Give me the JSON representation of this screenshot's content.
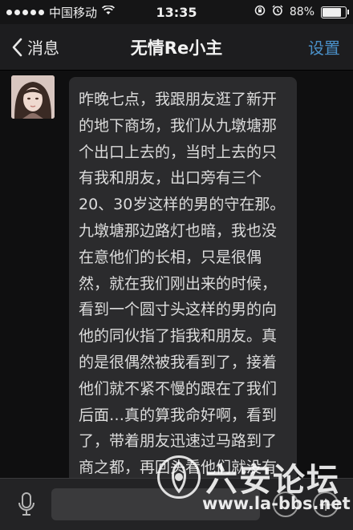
{
  "status_bar": {
    "carrier": "中国移动",
    "time": "13:35",
    "battery_percent_label": "88%",
    "battery_level": 0.88
  },
  "nav": {
    "back_label": "消息",
    "title": "无情Re小主",
    "settings_label": "设置"
  },
  "message": {
    "text": "昨晚七点，我跟朋友逛了新开的地下商场，我们从九墩塘那个出口上去的，当时上去的只有我和朋友，出口旁有三个20、30岁这样的男的守在那。九墩塘那边路灯也暗，我也没在意他们的长相，只是很偶然，就在我们刚出来的时候，看到一个圆寸头这样的男的向他的同伙指了指我和朋友。真的是很偶然被我看到了，接着他们就不紧不慢的跟在了我们后面…真的算我命好啊，看到了，带着朋友迅速过马路到了商之都，再回头看他们就没有过马路了"
  },
  "watermark": {
    "title": "六安论坛",
    "url": "www.la-bbs.net"
  },
  "icons": {
    "back": "chevron-left-icon",
    "wifi": "wifi-icon",
    "lock_rotation": "orientation-lock-icon",
    "alarm": "alarm-icon",
    "battery": "battery-icon",
    "mic": "microphone-icon",
    "emoji": "emoji-icon",
    "plus": "plus-icon"
  },
  "colors": {
    "accent": "#4a90c8",
    "bubble": "#2b2b2d",
    "background": "#0f0f10"
  }
}
